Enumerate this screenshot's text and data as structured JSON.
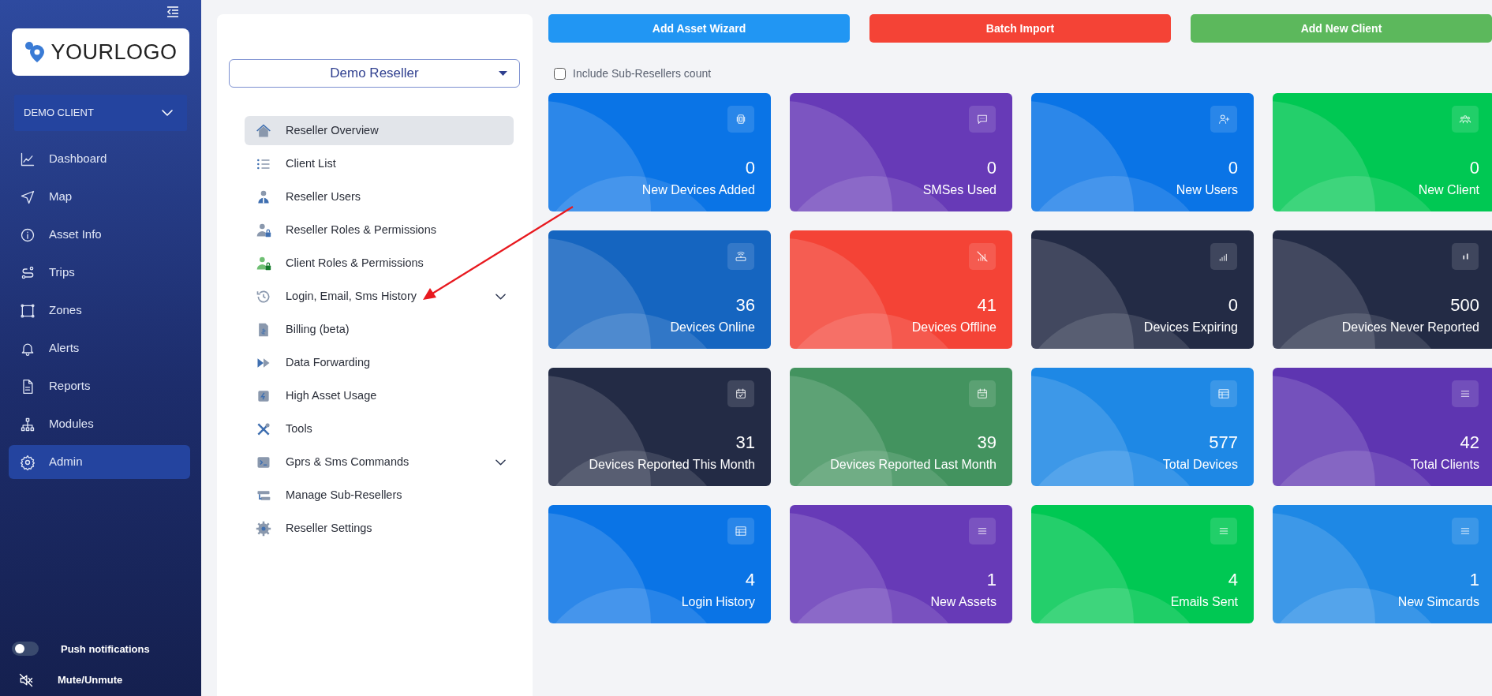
{
  "sidebar": {
    "logo_text": "**YOUR**LOGO",
    "client_select": "DEMO CLIENT",
    "items": [
      {
        "label": "Dashboard",
        "selected": false
      },
      {
        "label": "Map",
        "selected": false
      },
      {
        "label": "Asset Info",
        "selected": false
      },
      {
        "label": "Trips",
        "selected": false
      },
      {
        "label": "Zones",
        "selected": false
      },
      {
        "label": "Alerts",
        "selected": false
      },
      {
        "label": "Reports",
        "selected": false
      },
      {
        "label": "Modules",
        "selected": false
      },
      {
        "label": "Admin",
        "selected": true
      }
    ],
    "push_notifications": {
      "label": "Push notifications",
      "on": false
    },
    "mute": {
      "label": "Mute/Unmute"
    }
  },
  "reseller_menu": {
    "select": "Demo Reseller",
    "items": [
      {
        "label": "Reseller Overview",
        "kind": "link",
        "selected": true
      },
      {
        "label": "Client List",
        "kind": "link",
        "selected": false
      },
      {
        "label": "Reseller Users",
        "kind": "link",
        "selected": false
      },
      {
        "label": "Reseller Roles & Permissions",
        "kind": "link",
        "selected": false
      },
      {
        "label": "Client Roles & Permissions",
        "kind": "link",
        "selected": false
      },
      {
        "label": "Login, Email, Sms History",
        "kind": "submenu",
        "selected": false
      },
      {
        "label": "Billing (beta)",
        "kind": "link",
        "selected": false
      },
      {
        "label": "Data Forwarding",
        "kind": "link",
        "selected": false
      },
      {
        "label": "High Asset Usage",
        "kind": "link",
        "selected": false
      },
      {
        "label": "Tools",
        "kind": "link",
        "selected": false
      },
      {
        "label": "Gprs & Sms Commands",
        "kind": "submenu",
        "selected": false
      },
      {
        "label": "Manage Sub-Resellers",
        "kind": "link",
        "selected": false
      },
      {
        "label": "Reseller Settings",
        "kind": "link",
        "selected": false
      }
    ]
  },
  "actions": [
    {
      "label": "Add Asset Wizard",
      "color": "#2196f3"
    },
    {
      "label": "Batch Import",
      "color": "#f44336"
    },
    {
      "label": "Add New Client",
      "color": "#5cb85c"
    }
  ],
  "include_sub_resellers": {
    "label": "Include Sub-Resellers count",
    "checked": false
  },
  "stats": [
    {
      "value": "0",
      "label": "New Devices Added",
      "color": "#0a74e6",
      "kind": "chip"
    },
    {
      "value": "0",
      "label": "SMSes Used",
      "color": "#673ab7",
      "kind": "chat"
    },
    {
      "value": "0",
      "label": "New Users",
      "color": "#0a74e6",
      "kind": "userplus"
    },
    {
      "value": "0",
      "label": "New Client",
      "color": "#00c853",
      "kind": "group"
    },
    {
      "value": "36",
      "label": "Devices Online",
      "color": "#1565c0",
      "kind": "router"
    },
    {
      "value": "41",
      "label": "Devices Offline",
      "color": "#f44336",
      "kind": "nosignal"
    },
    {
      "value": "0",
      "label": "Devices Expiring",
      "color": "#232b45",
      "kind": "signal"
    },
    {
      "value": "500",
      "label": "Devices Never Reported",
      "color": "#232b45",
      "kind": "signallow"
    },
    {
      "value": "31",
      "label": "Devices Reported This Month",
      "color": "#232b45",
      "kind": "calcheck"
    },
    {
      "value": "39",
      "label": "Devices Reported Last Month",
      "color": "#43935f",
      "kind": "calendar"
    },
    {
      "value": "577",
      "label": "Total Devices",
      "color": "#1e88e5",
      "kind": "table"
    },
    {
      "value": "42",
      "label": "Total Clients",
      "color": "#5e35b1",
      "kind": "list"
    },
    {
      "value": "4",
      "label": "Login History",
      "color": "#0a74e6",
      "kind": "table"
    },
    {
      "value": "1",
      "label": "New Assets",
      "color": "#673ab7",
      "kind": "list"
    },
    {
      "value": "4",
      "label": "Emails Sent",
      "color": "#00c853",
      "kind": "list"
    },
    {
      "value": "1",
      "label": "New Simcards",
      "color": "#1e88e5",
      "kind": "list"
    }
  ]
}
